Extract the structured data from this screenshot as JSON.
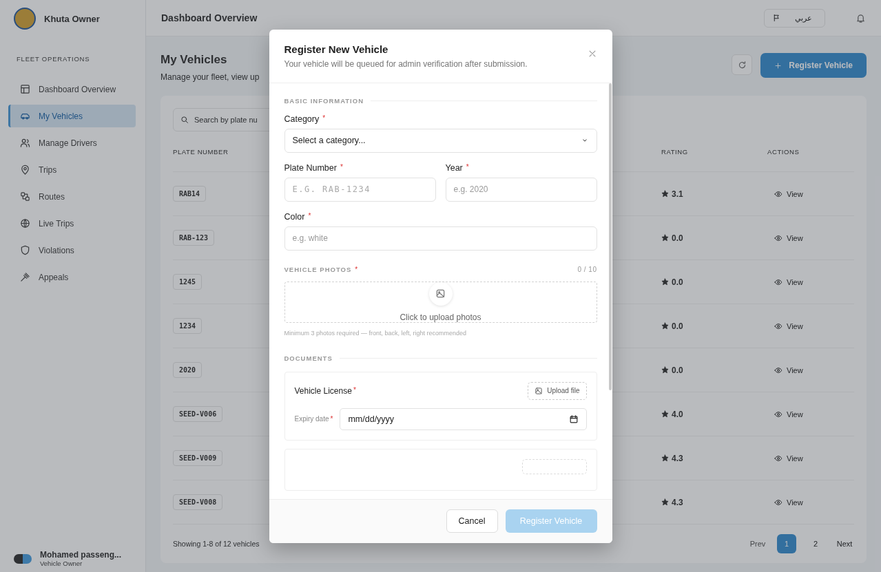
{
  "app": {
    "brand": "Khuta Owner",
    "header_title": "Dashboard Overview",
    "language": {
      "label": "عربي",
      "selected": false
    }
  },
  "sidebar": {
    "section": "FLEET OPERATIONS",
    "items": [
      {
        "label": "Dashboard Overview",
        "selected": false
      },
      {
        "label": "My Vehicles",
        "selected": true
      },
      {
        "label": "Manage Drivers",
        "selected": false
      },
      {
        "label": "Trips",
        "selected": false
      },
      {
        "label": "Routes",
        "selected": false
      },
      {
        "label": "Live Trips",
        "selected": false
      },
      {
        "label": "Violations",
        "selected": false
      },
      {
        "label": "Appeals",
        "selected": false
      }
    ],
    "user": {
      "name": "Mohamed passeng...",
      "role": "Vehicle Owner"
    }
  },
  "page": {
    "title": "My Vehicles",
    "subtitle": "Manage your fleet, view up",
    "action": "Register Vehicle",
    "search_placeholder": "Search by plate nu"
  },
  "table": {
    "columns": [
      "PLATE NUMBER",
      "RATING",
      "ACTIONS"
    ],
    "rows": [
      {
        "plate": "RAB14",
        "rating": "3.1",
        "action": "View"
      },
      {
        "plate": "RAB-123",
        "rating": "0.0",
        "action": "View"
      },
      {
        "plate": "1245",
        "rating": "0.0",
        "action": "View"
      },
      {
        "plate": "1234",
        "rating": "0.0",
        "action": "View"
      },
      {
        "plate": "2020",
        "rating": "0.0",
        "action": "View"
      },
      {
        "plate": "SEED-V006",
        "rating": "4.0",
        "action": "View"
      },
      {
        "plate": "SEED-V009",
        "rating": "4.3",
        "action": "View"
      },
      {
        "plate": "SEED-V008",
        "rating": "4.3",
        "action": "View"
      }
    ]
  },
  "pagination": {
    "summary": "Showing 1-8 of 12 vehicles",
    "prev": "Prev",
    "next": "Next",
    "pages": [
      {
        "label": "1",
        "selected": true
      },
      {
        "label": "2",
        "selected": false
      }
    ]
  },
  "modal": {
    "title": "Register New Vehicle",
    "subtitle": "Your vehicle will be queued for admin verification after submission.",
    "basic_heading": "BASIC INFORMATION",
    "fields": [
      {
        "kind": "select",
        "label": "Category",
        "mark": "*",
        "placeholder": "Select a category..."
      },
      {
        "kind": "mono",
        "label": "Plate Number",
        "mark": "*",
        "placeholder": "E.G. RAB-1234"
      },
      {
        "kind": "text",
        "label": "Year",
        "mark": "*",
        "placeholder": "e.g. 2020"
      },
      {
        "kind": "text",
        "label": "Color",
        "mark": "*",
        "placeholder": "e.g. white"
      }
    ],
    "photos": {
      "heading": "VEHICLE PHOTOS",
      "mark": "*",
      "count": "0 / 10",
      "upload_text": "Click to upload photos",
      "hint": "Minimum 3 photos required — front, back, left, right recommended"
    },
    "documents": {
      "heading": "DOCUMENTS",
      "items": [
        {
          "title": "Vehicle License",
          "mark": "*",
          "upload": "Upload file",
          "expiry_label": "Expiry date",
          "expiry_mark": "*",
          "date_placeholder": "mm/dd/yyyy"
        }
      ]
    },
    "cancel": "Cancel",
    "submit": {
      "label": "Register Vehicle",
      "disabled": true
    }
  }
}
